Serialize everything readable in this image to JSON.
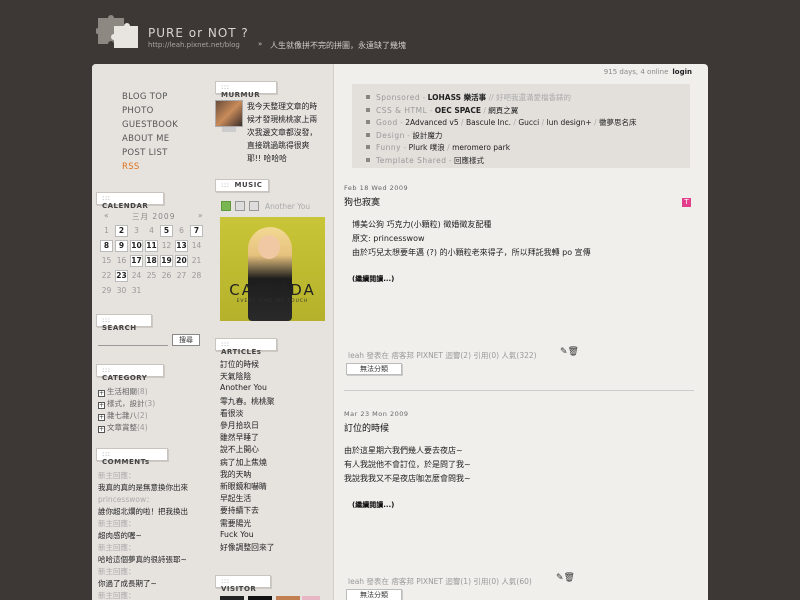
{
  "header": {
    "title": "PURE or NOT ?",
    "url": "http://leah.pixnet.net/blog",
    "separator": "»",
    "tagline": "人生就像拼不完的拼圖，永遠缺了幾塊"
  },
  "nav": {
    "items": [
      {
        "label": "BLOG TOP"
      },
      {
        "label": "PHOTO"
      },
      {
        "label": "GUESTBOOK"
      },
      {
        "label": "ABOUT ME"
      },
      {
        "label": "POST LIST"
      },
      {
        "label": "RSS"
      }
    ]
  },
  "sections": {
    "calendar": "CALENDAR",
    "search": "SEARCH",
    "category": "CATEGORY",
    "comments": "COMMENTs",
    "murmur": "MURMUR",
    "music": "MUSIC",
    "articles": "ARTICLEs",
    "visitor": "VISITOR",
    "dots": ":::"
  },
  "calendar": {
    "prev": "«",
    "next": "»",
    "month": "三月 2009",
    "weeks": [
      [
        {
          "d": "1",
          "link": false
        },
        {
          "d": "2",
          "link": true
        },
        {
          "d": "3",
          "link": false
        },
        {
          "d": "4",
          "link": false
        },
        {
          "d": "5",
          "link": true
        },
        {
          "d": "6",
          "link": false
        },
        {
          "d": "7",
          "link": true
        }
      ],
      [
        {
          "d": "8",
          "link": true
        },
        {
          "d": "9",
          "link": true
        },
        {
          "d": "10",
          "link": true
        },
        {
          "d": "11",
          "link": true
        },
        {
          "d": "12",
          "link": false
        },
        {
          "d": "13",
          "link": true
        },
        {
          "d": "14",
          "link": false
        }
      ],
      [
        {
          "d": "15",
          "link": false
        },
        {
          "d": "16",
          "link": false
        },
        {
          "d": "17",
          "link": true
        },
        {
          "d": "18",
          "link": true
        },
        {
          "d": "19",
          "link": true
        },
        {
          "d": "20",
          "link": true
        },
        {
          "d": "21",
          "link": false
        }
      ],
      [
        {
          "d": "22",
          "link": false
        },
        {
          "d": "23",
          "link": true
        },
        {
          "d": "24",
          "link": false
        },
        {
          "d": "25",
          "link": false
        },
        {
          "d": "26",
          "link": false
        },
        {
          "d": "27",
          "link": false
        },
        {
          "d": "28",
          "link": false
        }
      ],
      [
        {
          "d": "29",
          "link": false
        },
        {
          "d": "30",
          "link": false
        },
        {
          "d": "31",
          "link": false
        }
      ]
    ]
  },
  "search": {
    "value": "",
    "button": "搜尋"
  },
  "categories": [
    {
      "label": "生活相關",
      "count": "(8)"
    },
    {
      "label": "樣式，設計",
      "count": "(3)"
    },
    {
      "label": "雜七雜八",
      "count": "(2)"
    },
    {
      "label": "文章賞整",
      "count": "(4)"
    }
  ],
  "comments": [
    {
      "meta": "新主回應：",
      "body": "我真的真的是無意換你出來"
    },
    {
      "meta": "princesswow：",
      "body": "誰你超北爛的啦！把我換出"
    },
    {
      "meta": "新主回應：",
      "body": "超肉感的喔~"
    },
    {
      "meta": "新主回應：",
      "body": "哈哈這個夢真的很詩張耶~"
    },
    {
      "meta": "新主回應：",
      "body": "你過了成長期了~"
    },
    {
      "meta": "新主回應：",
      "body": ""
    }
  ],
  "murmur": {
    "lines": [
      "我今天整理文章的時",
      "候才發現桃桃家上兩",
      "次我邊文章都沒發，",
      "直接跳過跳得很爽",
      "耶!! 哈哈哈"
    ]
  },
  "music": {
    "track": "Another You",
    "album_title": "CASCADA",
    "album_sub": "EVERY TIME WE TOUCH"
  },
  "articles": [
    "訂位的時候",
    "天氣陰陰",
    "Another You",
    "零九春。桃桃聚",
    "看很淡",
    "參月拾玖日",
    "雖然早睡了",
    "說不上開心",
    "病了加上焦燒",
    "我的天呐",
    "新眼鏡和嚇睛",
    "早起生活",
    "要持續下去",
    "需要陽光",
    "Fuck You",
    "好像調整回來了"
  ],
  "status": {
    "text": "915 days, 4 online",
    "login": "login"
  },
  "links": [
    {
      "label": "Sponsored",
      "items": [
        {
          "t": "LOHASS 樂活事",
          "b": true
        }
      ],
      "extra": "// 好吧我還滿愛檔香錶的"
    },
    {
      "label": "CSS & HTML",
      "items": [
        {
          "t": "OEC SPACE",
          "b": true
        },
        {
          "t": "網頁之翼",
          "b": false
        }
      ],
      "extra": ""
    },
    {
      "label": "Good",
      "items": [
        {
          "t": "2Advanced v5",
          "b": false
        },
        {
          "t": "Bascule Inc.",
          "b": false
        },
        {
          "t": "Gucci",
          "b": false
        },
        {
          "t": "lun design+",
          "b": false
        },
        {
          "t": "黴夢思名床",
          "b": false
        }
      ],
      "extra": ""
    },
    {
      "label": "Design",
      "items": [
        {
          "t": "設計魔力",
          "b": false
        }
      ],
      "extra": ""
    },
    {
      "label": "Funny",
      "items": [
        {
          "t": "Plurk 噗浪",
          "b": false
        },
        {
          "t": "meromero park",
          "b": false
        }
      ],
      "extra": ""
    },
    {
      "label": "Template Shared",
      "items": [
        {
          "t": "回應樣式",
          "b": false
        }
      ],
      "extra": ""
    }
  ],
  "posts": [
    {
      "date": "Feb 18 Wed 2009",
      "title": "狗也寂寞",
      "lines": [
        "博美公狗 巧克力(小顆粒) 徵婚徵友配種",
        "原文: princesswow",
        "由於巧兒太想要年邁 (?) 的小顆粒老來得子，所以拜託我轉 po 宣傳"
      ],
      "more": "(繼續閱讀...)",
      "meta": "leah 發表在 痞客邦 PIXNET 迴響(2) 引用(0) 人氣(322)",
      "category": "無法分類"
    },
    {
      "date": "Mar 23 Mon 2009",
      "title": "訂位的時候",
      "lines": [
        "由於這星期六我們幾人要去夜店~",
        "有人我說他不會訂位，於是問了我~",
        "我說我我又不是夜店咖怎麼會問我~"
      ],
      "more": "(繼續閱讀...)",
      "meta": "leah 發表在 痞客邦 PIXNET 迴響(1) 引用(0) 人氣(60)",
      "category": "無法分類"
    }
  ]
}
